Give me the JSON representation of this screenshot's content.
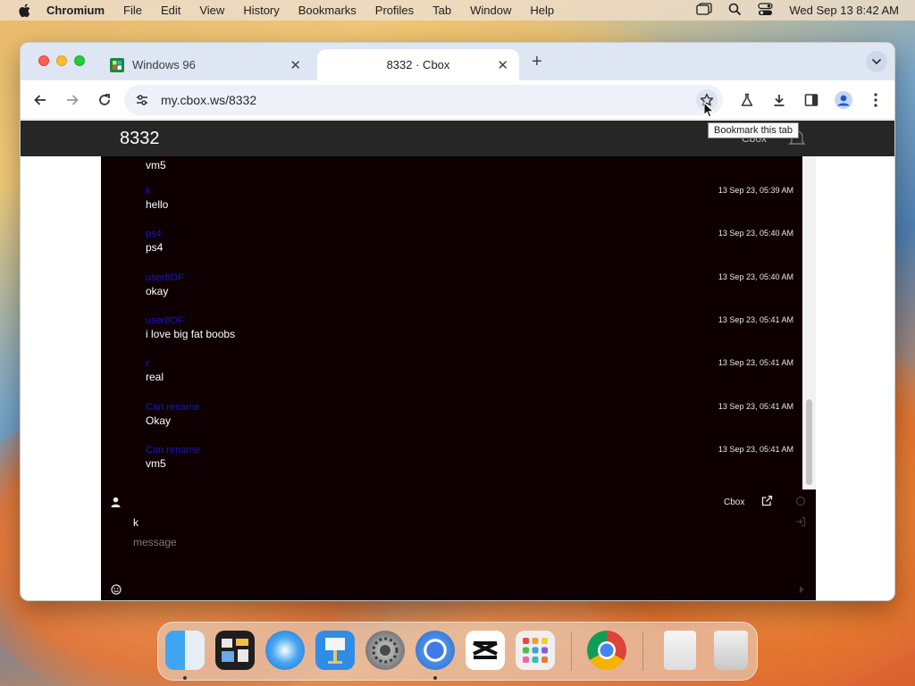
{
  "menubar": {
    "items": [
      "Chromium",
      "File",
      "Edit",
      "View",
      "History",
      "Bookmarks",
      "Profiles",
      "Tab",
      "Window",
      "Help"
    ],
    "clock": "Wed Sep 13  8:42 AM"
  },
  "browser": {
    "tabs": [
      {
        "title": "Windows 96",
        "active": false
      },
      {
        "title": "8332 · Cbox",
        "active": true
      }
    ],
    "address": "my.cbox.ws/8332",
    "tooltip": "Bookmark this tab"
  },
  "site": {
    "title": "8332",
    "header_link": "Cbox"
  },
  "chat": {
    "partial_top_text": "vm5",
    "messages": [
      {
        "user": "k",
        "time": "13 Sep 23, 05:39 AM",
        "text": "hello"
      },
      {
        "user": "ps4",
        "time": "13 Sep 23, 05:40 AM",
        "text": "ps4"
      },
      {
        "user": "user8OF",
        "time": "13 Sep 23, 05:40 AM",
        "text": "okay"
      },
      {
        "user": "user8OF",
        "time": "13 Sep 23, 05:41 AM",
        "text": "i love big fat boobs"
      },
      {
        "user": "r",
        "time": "13 Sep 23, 05:41 AM",
        "text": "real"
      },
      {
        "user": "Can rename",
        "time": "13 Sep 23, 05:41 AM",
        "text": "Okay"
      },
      {
        "user": "Can rename",
        "time": "13 Sep 23, 05:41 AM",
        "text": "vm5"
      }
    ],
    "composer": {
      "brand": "Cbox",
      "name_value": "k",
      "message_placeholder": "message"
    }
  },
  "dock": {
    "apps": [
      "Finder",
      "Mission Control",
      "Safari",
      "Keynote",
      "System Settings",
      "Chromium",
      "CapCut",
      "Launchpad",
      "Google Chrome",
      "Documents",
      "Trash"
    ]
  }
}
